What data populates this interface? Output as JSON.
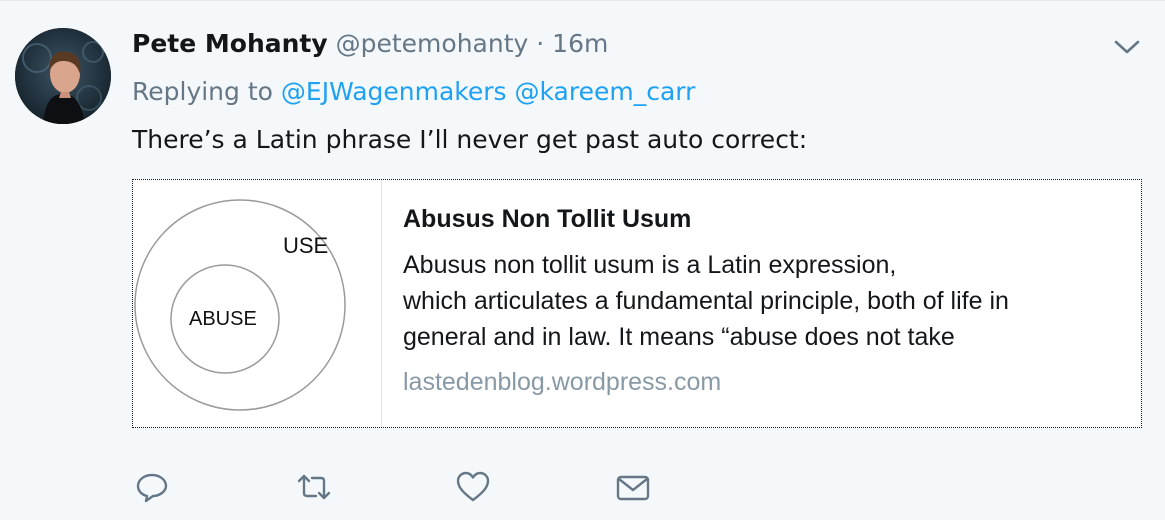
{
  "tweet": {
    "author": {
      "name": "Pete Mohanty",
      "handle": "@petemohanty",
      "separator": "·",
      "time": "16m"
    },
    "reply": {
      "prefix": "Replying to",
      "mentions": [
        "@EJWagenmakers",
        "@kareem_carr"
      ]
    },
    "text": "There’s a Latin phrase I’ll never get past auto correct:"
  },
  "card": {
    "image_labels": {
      "outer": "USE",
      "inner": "ABUSE"
    },
    "title": "Abusus Non Tollit Usum",
    "description_lines": [
      "Abusus non tollit usum is a Latin expression,",
      "which articulates a fundamental principle, both of life in",
      "general and in law.  It means “abuse does not take"
    ],
    "domain": "lastedenblog.wordpress.com"
  },
  "actions": {
    "icons": [
      "reply-icon",
      "retweet-icon",
      "like-icon",
      "dm-icon"
    ]
  },
  "colors": {
    "background": "#f5f8fa",
    "link": "#1da1f2",
    "secondary_text": "#657786",
    "icon": "#657786"
  }
}
